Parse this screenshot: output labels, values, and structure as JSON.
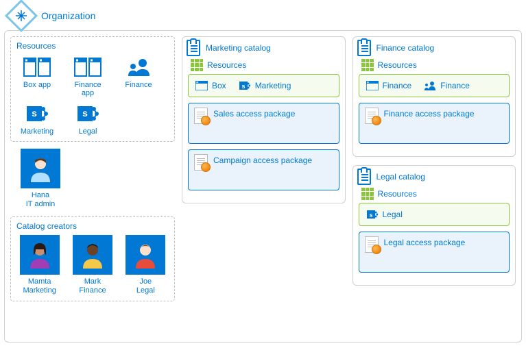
{
  "organization": {
    "title": "Organization"
  },
  "resources_panel": {
    "label": "Resources",
    "items": [
      {
        "label": "Box app",
        "icon": "app"
      },
      {
        "label": "Finance app",
        "icon": "app"
      },
      {
        "label": "Finance",
        "icon": "group"
      },
      {
        "label": "Marketing",
        "icon": "sharepoint"
      },
      {
        "label": "Legal",
        "icon": "sharepoint"
      }
    ]
  },
  "admin": {
    "name": "Hana",
    "role": "IT admin"
  },
  "catalog_creators": {
    "label": "Catalog creators",
    "people": [
      {
        "name": "Mamta",
        "role": "Marketing"
      },
      {
        "name": "Mark",
        "role": "Finance"
      },
      {
        "name": "Joe",
        "role": "Legal"
      }
    ]
  },
  "catalogs": [
    {
      "title": "Marketing catalog",
      "resources_label": "Resources",
      "resources": [
        {
          "label": "Box",
          "icon": "app"
        },
        {
          "label": "Marketing",
          "icon": "sharepoint"
        }
      ],
      "packages": [
        {
          "title": "Sales access package"
        },
        {
          "title": "Campaign access package"
        }
      ]
    },
    {
      "title": "Finance catalog",
      "resources_label": "Resources",
      "resources": [
        {
          "label": "Finance",
          "icon": "app"
        },
        {
          "label": "Finance",
          "icon": "group"
        }
      ],
      "packages": [
        {
          "title": "Finance access package"
        }
      ]
    },
    {
      "title": "Legal catalog",
      "resources_label": "Resources",
      "resources": [
        {
          "label": "Legal",
          "icon": "sharepoint"
        }
      ],
      "packages": [
        {
          "title": "Legal access package"
        }
      ]
    }
  ]
}
